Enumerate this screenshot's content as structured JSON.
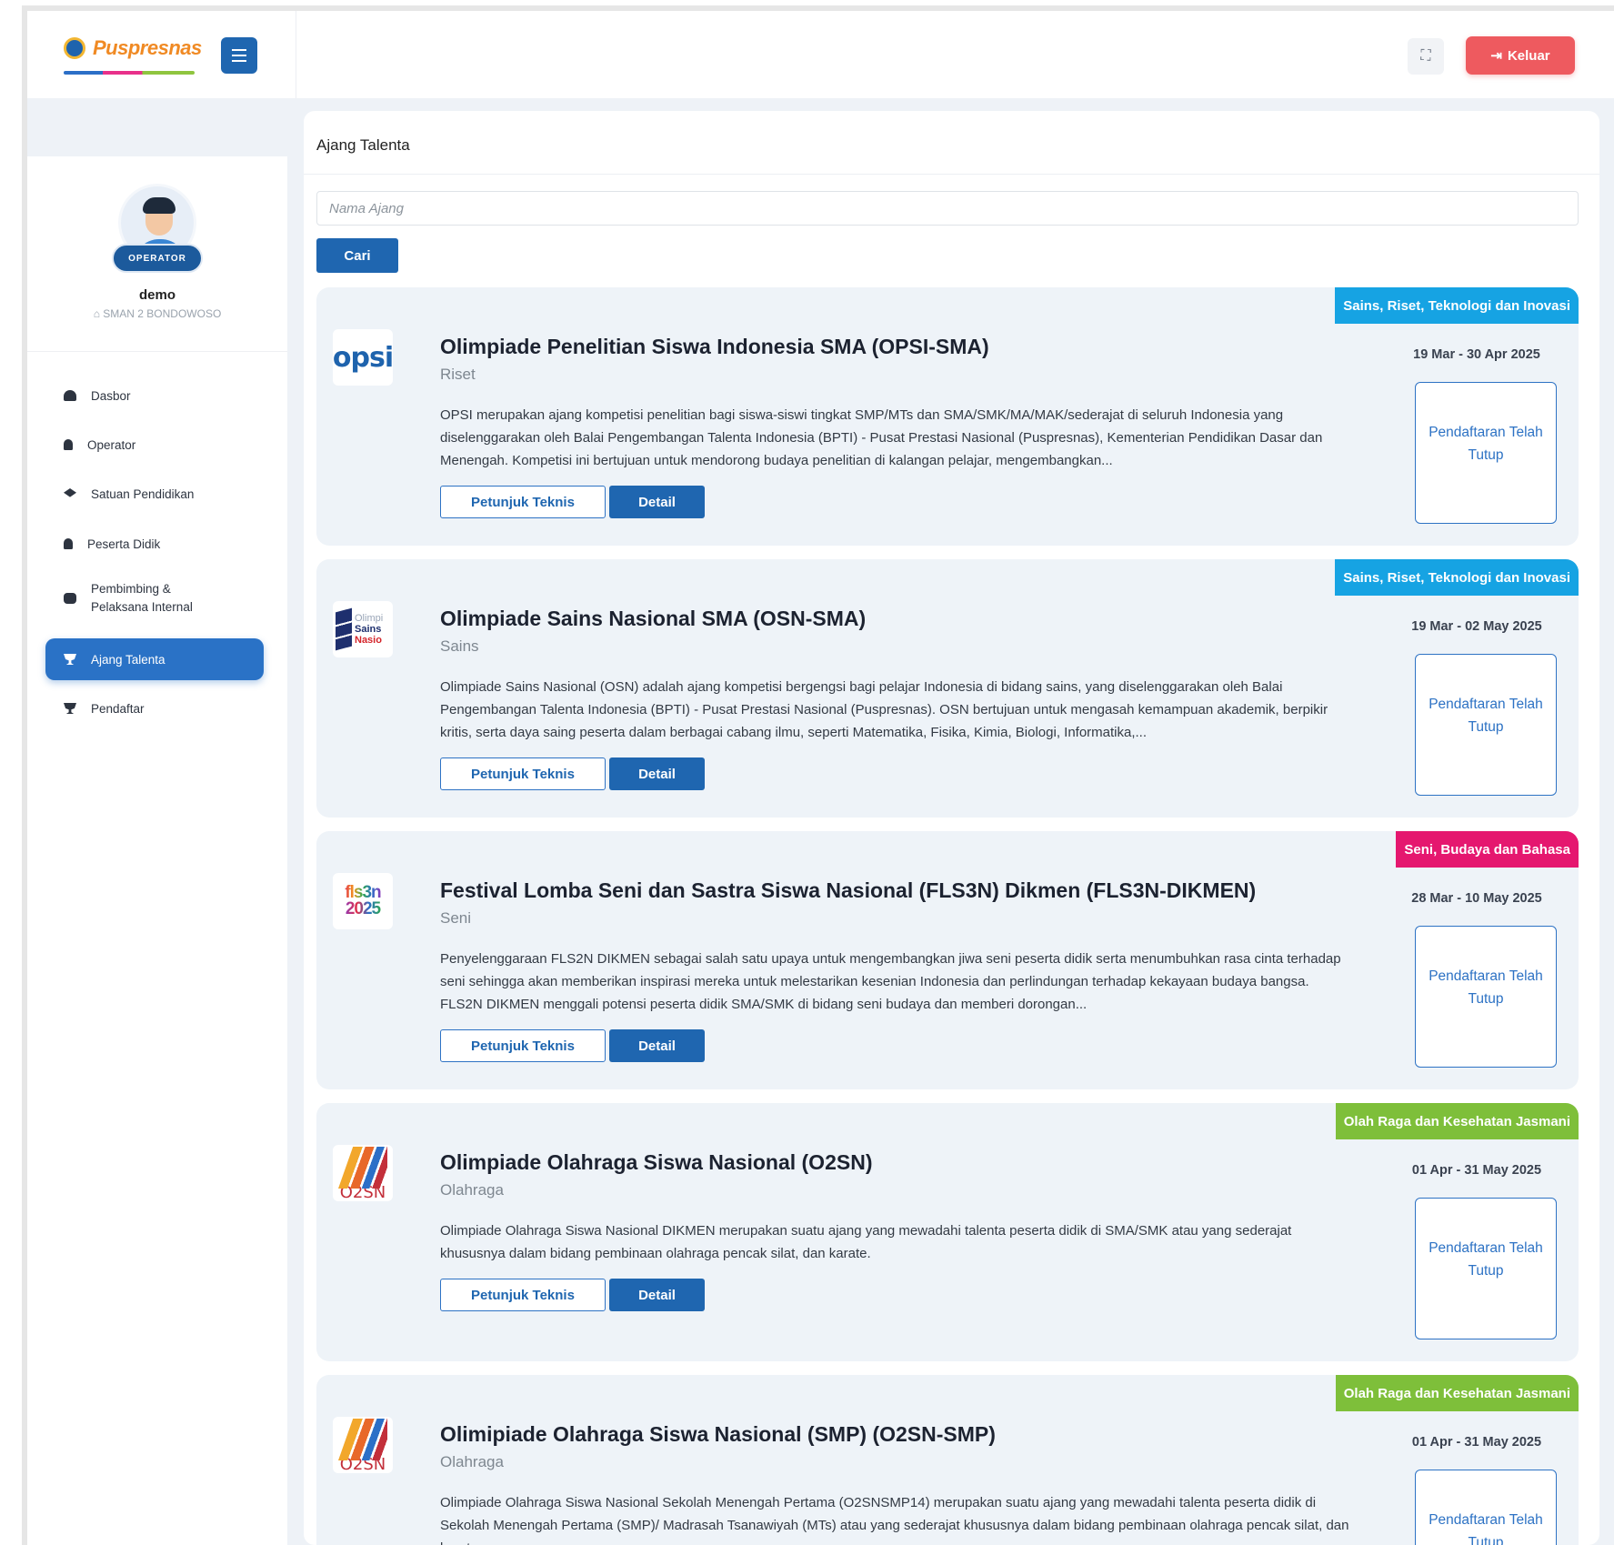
{
  "header": {
    "logo_text": "Puspresnas",
    "logout_label": "Keluar"
  },
  "icons": {
    "menu": "hamburger-icon",
    "fullscreen": "fullscreen-icon",
    "logout": "logout-icon"
  },
  "colors": {
    "primary": "#1f66b0",
    "danger": "#ee5a5f",
    "cat_blue": "#16a3e3",
    "cat_pink": "#e5176f",
    "cat_green": "#7ebf3a"
  },
  "sidebar": {
    "role_badge": "OPERATOR",
    "user_name": "demo",
    "user_school": "SMAN 2 BONDOWOSO",
    "items": [
      {
        "label": "Dasbor",
        "icon": "dashboard-icon",
        "active": false
      },
      {
        "label": "Operator",
        "icon": "user-icon",
        "active": false
      },
      {
        "label": "Satuan Pendidikan",
        "icon": "graduation-cap-icon",
        "active": false
      },
      {
        "label": "Peserta Didik",
        "icon": "user-icon",
        "active": false
      },
      {
        "label": "Pembimbing & Pelaksana Internal",
        "icon": "users-icon",
        "active": false
      },
      {
        "label": "Ajang Talenta",
        "icon": "trophy-icon",
        "active": true
      },
      {
        "label": "Pendaftar",
        "icon": "trophy-icon",
        "active": false
      }
    ]
  },
  "main": {
    "title": "Ajang Talenta",
    "search_placeholder": "Nama Ajang",
    "search_value": "",
    "search_button": "Cari",
    "button_juknis": "Petunjuk Teknis",
    "button_detail": "Detail",
    "cards": [
      {
        "category": "Sains, Riset, Teknologi dan Inovasi",
        "title": "Olimpiade Penelitian Siswa Indonesia SMA (OPSI-SMA)",
        "subtitle": "Riset",
        "description": "OPSI merupakan ajang kompetisi penelitian bagi siswa-siswi tingkat SMP/MTs dan SMA/SMK/MA/MAK/sederajat di seluruh Indonesia yang diselenggarakan oleh Balai Pengembangan Talenta Indonesia (BPTI) - Pusat Prestasi Nasional (Puspresnas), Kementerian Pendidikan Dasar dan Menengah. Kompetisi ini bertujuan untuk mendorong budaya penelitian di kalangan pelajar, mengembangkan...",
        "date": "19 Mar - 30 Apr 2025",
        "status": "Pendaftaran Telah Tutup"
      },
      {
        "category": "Sains, Riset, Teknologi dan Inovasi",
        "title": "Olimpiade Sains Nasional SMA (OSN-SMA)",
        "subtitle": "Sains",
        "description": "Olimpiade Sains Nasional (OSN) adalah ajang kompetisi bergengsi bagi pelajar Indonesia di bidang sains, yang diselenggarakan oleh Balai Pengembangan Talenta Indonesia (BPTI) - Pusat Prestasi Nasional (Puspresnas). OSN bertujuan untuk mengasah kemampuan akademik, berpikir kritis, serta daya saing peserta dalam berbagai cabang ilmu, seperti Matematika, Fisika, Kimia, Biologi, Informatika,...",
        "date": "19 Mar - 02 May 2025",
        "status": "Pendaftaran Telah Tutup"
      },
      {
        "category": "Seni, Budaya dan Bahasa",
        "title": "Festival Lomba Seni dan Sastra Siswa Nasional (FLS3N) Dikmen (FLS3N-DIKMEN)",
        "subtitle": "Seni",
        "description": "Penyelenggaraan FLS2N DIKMEN sebagai salah satu upaya untuk mengembangkan jiwa seni peserta didik serta menumbuhkan rasa cinta terhadap seni sehingga akan memberikan inspirasi mereka untuk melestarikan kesenian Indonesia dan perlindungan terhadap kekayaan budaya bangsa. FLS2N DIKMEN menggali potensi peserta didik SMA/SMK di bidang seni budaya dan memberi dorongan...",
        "date": "28 Mar - 10 May 2025",
        "status": "Pendaftaran Telah Tutup"
      },
      {
        "category": "Olah Raga dan Kesehatan Jasmani",
        "title": "Olimpiade Olahraga Siswa Nasional (O2SN)",
        "subtitle": "Olahraga",
        "description": "Olimpiade Olahraga Siswa Nasional DIKMEN merupakan suatu ajang yang mewadahi talenta peserta didik di SMA/SMK atau yang sederajat khususnya dalam bidang pembinaan olahraga pencak silat, dan karate.",
        "date": "01 Apr - 31 May 2025",
        "status": "Pendaftaran Telah Tutup"
      },
      {
        "category": "Olah Raga dan Kesehatan Jasmani",
        "title": "Olimipiade Olahraga Siswa Nasional (SMP) (O2SN-SMP)",
        "subtitle": "Olahraga",
        "description": "Olimpiade Olahraga Siswa Nasional Sekolah Menengah Pertama (O2SNSMP14) merupakan suatu ajang yang mewadahi talenta peserta didik di Sekolah Menengah Pertama (SMP)/ Madrasah Tsanawiyah (MTs) atau yang sederajat khususnya dalam bidang pembinaan olahraga pencak silat, dan karate.",
        "date": "01 Apr - 31 May 2025",
        "status": "Pendaftaran Telah Tutup"
      }
    ],
    "logos": {
      "opsi": "opsi",
      "osn_line1": "Olimpi",
      "osn_line2": "Sains",
      "osn_line3": "Nasio",
      "fls_line1": "fls3n",
      "fls_line2": "2025",
      "o2sn": "O2SN"
    }
  }
}
